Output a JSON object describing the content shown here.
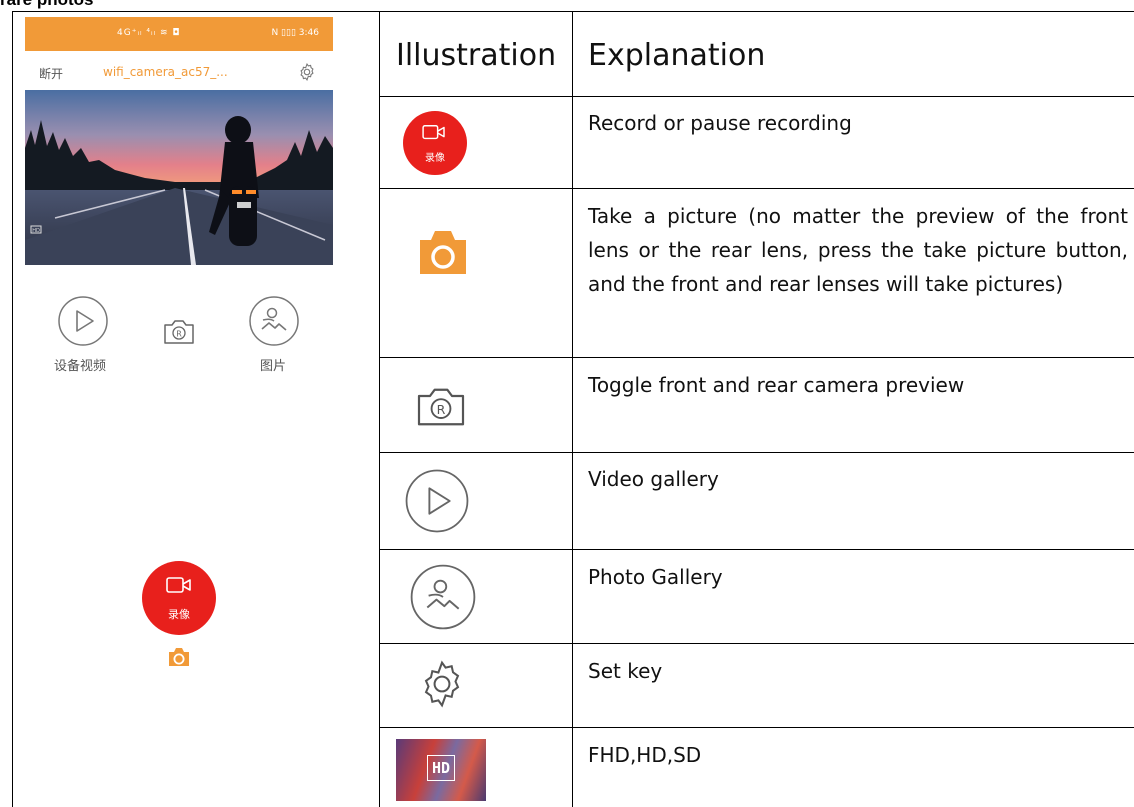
{
  "doc": {
    "top_clip_text": "rare photos"
  },
  "phone": {
    "status_left": "4G⁺ᵢₗ ⁴ᵢₗ ≋ ◘",
    "status_right": "N ▯▯▯ 3:46",
    "disconnect_label": "断开",
    "ssid": "wifi_camera_ac57_...",
    "hd_badge": "HD",
    "video_label": "设备视频",
    "photo_label": "图片",
    "record_label": "录像"
  },
  "table": {
    "header_illustration": "Illustration",
    "header_explanation": "Explanation",
    "rows": [
      {
        "explanation": "Record or pause recording",
        "icon_text": "录像"
      },
      {
        "explanation": "Take a picture (no matter the preview of the front lens or the rear lens, press the take picture button, and the front and rear lenses will take pictures)"
      },
      {
        "explanation": "Toggle front and rear camera preview"
      },
      {
        "explanation": "Video gallery"
      },
      {
        "explanation": "Photo Gallery"
      },
      {
        "explanation": "Set key"
      },
      {
        "explanation": "FHD,HD,SD",
        "icon_text": "HD"
      }
    ]
  },
  "colors": {
    "accent_orange": "#f19a38",
    "record_red": "#e8201c",
    "icon_gray": "#666666"
  }
}
